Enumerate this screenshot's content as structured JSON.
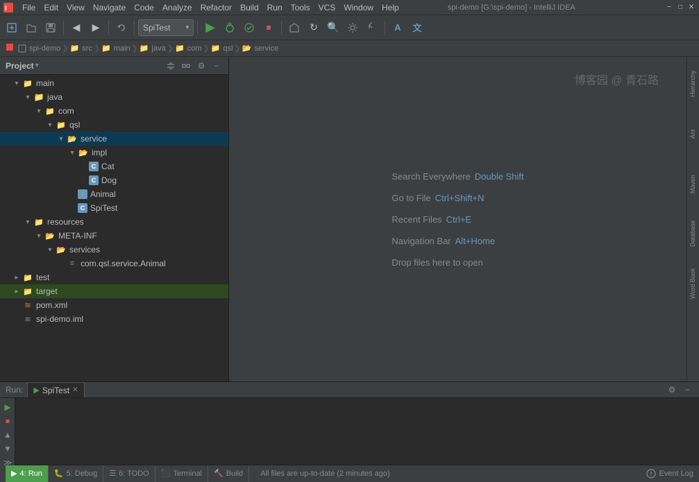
{
  "window": {
    "title": "spi-demo [G:\\spi-demo] - IntelliJ IDEA"
  },
  "menubar": {
    "items": [
      "File",
      "Edit",
      "View",
      "Navigate",
      "Code",
      "Analyze",
      "Refactor",
      "Build",
      "Run",
      "Tools",
      "VCS",
      "Window",
      "Help"
    ]
  },
  "toolbar": {
    "run_config": "SpiTest",
    "run_config_arrow": "▾"
  },
  "breadcrumb": {
    "items": [
      "spi-demo",
      "src",
      "main",
      "java",
      "com",
      "qsl",
      "service"
    ]
  },
  "project_panel": {
    "title": "Project",
    "tree": [
      {
        "id": "main",
        "label": "main",
        "type": "folder",
        "level": 1,
        "expanded": true
      },
      {
        "id": "java",
        "label": "java",
        "type": "src-folder",
        "level": 2,
        "expanded": true
      },
      {
        "id": "com",
        "label": "com",
        "type": "folder",
        "level": 3,
        "expanded": true
      },
      {
        "id": "qsl",
        "label": "qsl",
        "type": "folder",
        "level": 4,
        "expanded": true
      },
      {
        "id": "service",
        "label": "service",
        "type": "folder-open",
        "level": 5,
        "expanded": true,
        "selected": true
      },
      {
        "id": "impl",
        "label": "impl",
        "type": "folder-open",
        "level": 6,
        "expanded": true
      },
      {
        "id": "Cat",
        "label": "Cat",
        "type": "class",
        "level": 7
      },
      {
        "id": "Dog",
        "label": "Dog",
        "type": "class",
        "level": 7
      },
      {
        "id": "Animal",
        "label": "Animal",
        "type": "interface",
        "level": 6
      },
      {
        "id": "SpiTest",
        "label": "SpiTest",
        "type": "class",
        "level": 6
      },
      {
        "id": "resources",
        "label": "resources",
        "type": "res-folder",
        "level": 2,
        "expanded": true
      },
      {
        "id": "META-INF",
        "label": "META-INF",
        "type": "folder-open",
        "level": 3,
        "expanded": true
      },
      {
        "id": "services",
        "label": "services",
        "type": "folder-open",
        "level": 4,
        "expanded": true
      },
      {
        "id": "com.qsl.service.Animal",
        "label": "com.qsl.service.Animal",
        "type": "txt",
        "level": 5
      },
      {
        "id": "test",
        "label": "test",
        "type": "folder",
        "level": 1,
        "expanded": false
      },
      {
        "id": "target",
        "label": "target",
        "type": "folder",
        "level": 1,
        "expanded": false,
        "highlighted": true
      },
      {
        "id": "pom.xml",
        "label": "pom.xml",
        "type": "xml",
        "level": 1
      },
      {
        "id": "spi-demo.iml",
        "label": "spi-demo.iml",
        "type": "xml",
        "level": 1
      }
    ]
  },
  "editor": {
    "chinese_text": "博客园 @ 青石路",
    "shortcuts": [
      {
        "action": "Search Everywhere",
        "key": "Double Shift"
      },
      {
        "action": "Go to File",
        "key": "Ctrl+Shift+N"
      },
      {
        "action": "Recent Files",
        "key": "Ctrl+E"
      },
      {
        "action": "Navigation Bar",
        "key": "Alt+Home"
      },
      {
        "action": "Drop files here to open",
        "key": ""
      }
    ]
  },
  "right_tabs": [
    "Hierarchy",
    "Ant",
    "Maven",
    "Database",
    "Word Book"
  ],
  "bottom": {
    "run_label": "Run:",
    "run_tab": "SpiTest",
    "output_text": ""
  },
  "statusbar": {
    "tabs": [
      {
        "icon": "▶",
        "label": "4: Run",
        "active": true
      },
      {
        "icon": "🐛",
        "label": "5: Debug",
        "active": false
      },
      {
        "icon": "☰",
        "label": "6: TODO",
        "active": false
      },
      {
        "icon": "⬛",
        "label": "Terminal",
        "active": false
      },
      {
        "icon": "🔨",
        "label": "Build",
        "active": false
      }
    ],
    "message": "All files are up-to-date (2 minutes ago)",
    "event_log": "Event Log"
  }
}
